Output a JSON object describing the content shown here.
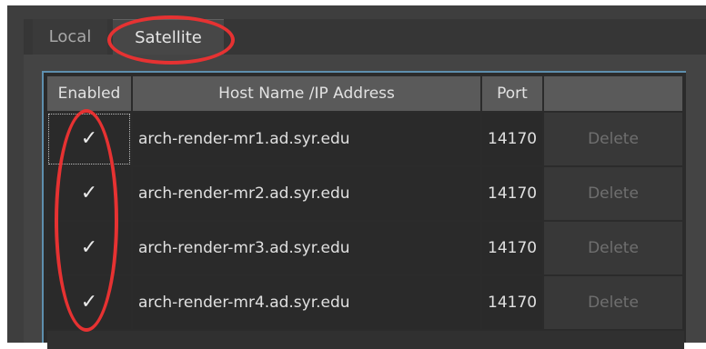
{
  "tabs": [
    {
      "label": "Local",
      "active": false
    },
    {
      "label": "Satellite",
      "active": true
    }
  ],
  "table": {
    "headers": {
      "enabled": "Enabled",
      "host": "Host Name /IP Address",
      "port": "Port",
      "actions": ""
    },
    "rows": [
      {
        "enabled": "✓",
        "host": "arch-render-mr1.ad.syr.edu",
        "port": "14170",
        "action": "Delete"
      },
      {
        "enabled": "✓",
        "host": "arch-render-mr2.ad.syr.edu",
        "port": "14170",
        "action": "Delete"
      },
      {
        "enabled": "✓",
        "host": "arch-render-mr3.ad.syr.edu",
        "port": "14170",
        "action": "Delete"
      },
      {
        "enabled": "✓",
        "host": "arch-render-mr4.ad.syr.edu",
        "port": "14170",
        "action": "Delete"
      }
    ]
  },
  "annotations": {
    "color": "#e63232"
  },
  "colors": {
    "grid_border": "#5e8fae",
    "header_bg": "#5a5a5a",
    "panel_bg": "#3e3e3e"
  }
}
